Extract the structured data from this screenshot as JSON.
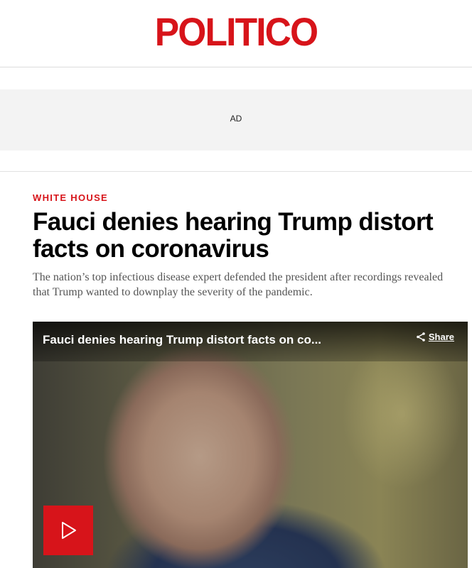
{
  "header": {
    "logo_text": "POLITICO"
  },
  "ad": {
    "label": "AD"
  },
  "article": {
    "section": "WHITE HOUSE",
    "headline": "Fauci denies hearing Trump distort facts on coronavirus",
    "dek": "The nation’s top infectious disease expert defended the president after recordings revealed that Trump wanted to downplay the severity of the pandemic."
  },
  "video": {
    "title": "Fauci denies hearing Trump distort facts on co...",
    "share_label": "Share",
    "play_icon": "play-icon",
    "share_icon": "share-icon"
  },
  "colors": {
    "brand_red": "#d7141a",
    "ad_background": "#f3f3f3",
    "dek_text": "#555555"
  }
}
